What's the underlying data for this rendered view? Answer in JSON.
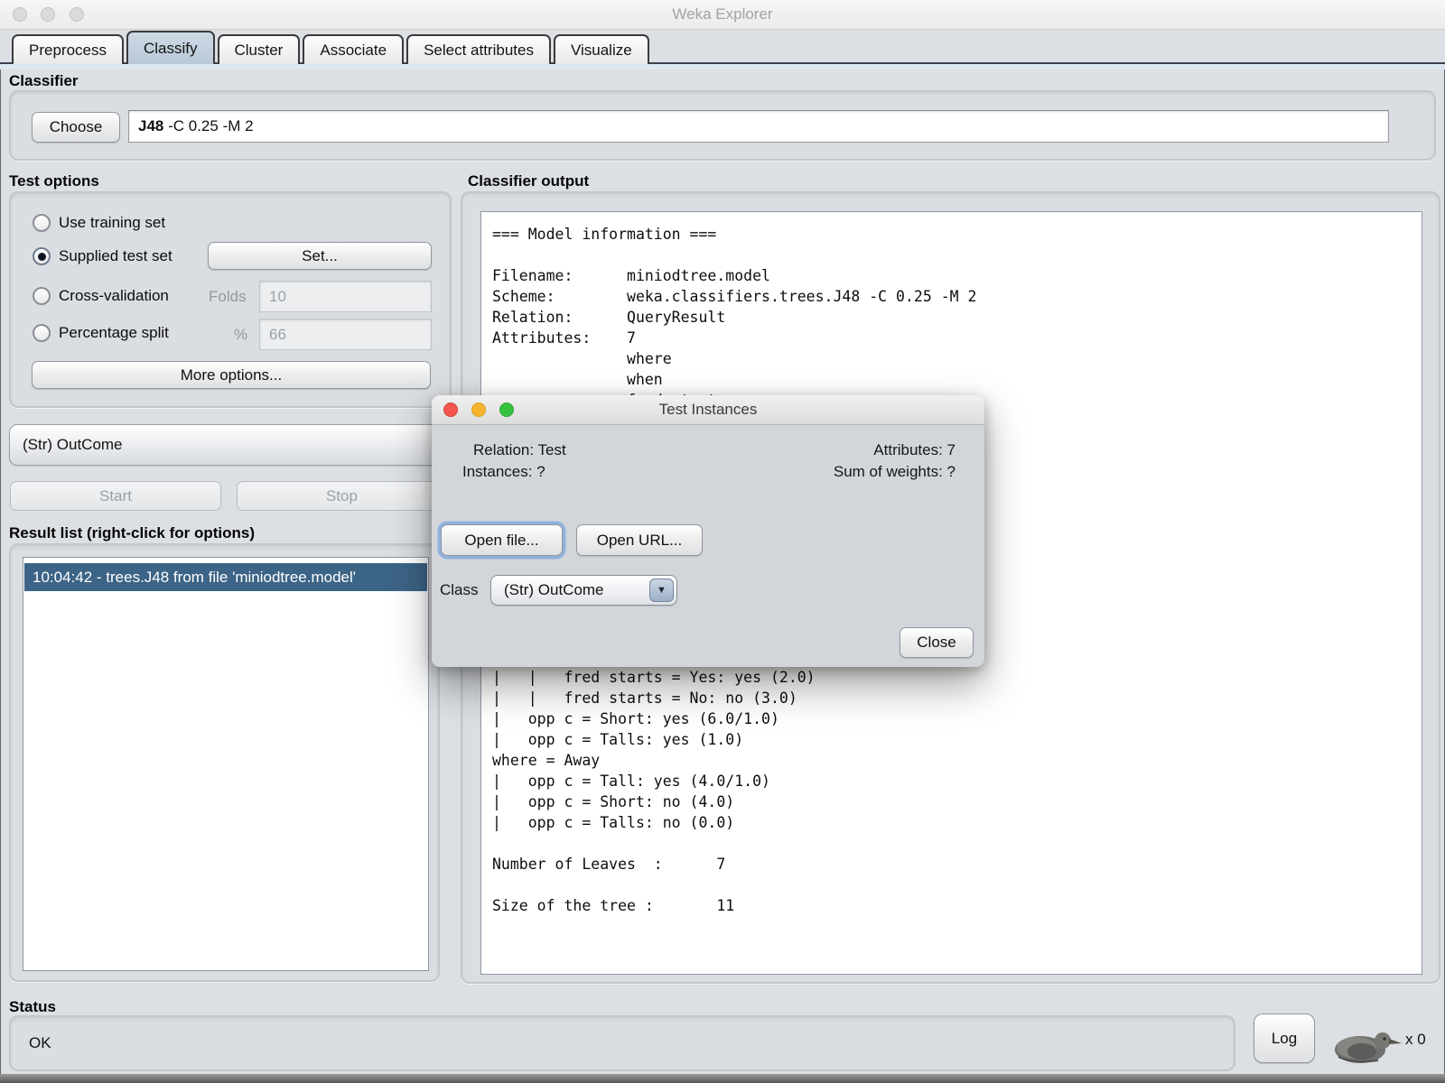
{
  "window": {
    "title": "Weka Explorer"
  },
  "tabs": {
    "items": [
      "Preprocess",
      "Classify",
      "Cluster",
      "Associate",
      "Select attributes",
      "Visualize"
    ],
    "selected": "Classify"
  },
  "classifier": {
    "section_label": "Classifier",
    "choose_button": "Choose",
    "name_bold": "J48",
    "name_rest": " -C 0.25 -M 2"
  },
  "test_options": {
    "section_label": "Test options",
    "use_training_set": "Use training set",
    "supplied_test_set": "Supplied test set",
    "set_button": "Set...",
    "cross_validation": "Cross-validation",
    "folds_label": "Folds",
    "folds_value": "10",
    "percentage_split": "Percentage split",
    "percent_label": "%",
    "percent_value": "66",
    "more_options_button": "More options..."
  },
  "class_combo": {
    "value": "(Str) OutCome"
  },
  "controls": {
    "start_button": "Start",
    "stop_button": "Stop"
  },
  "result_list": {
    "section_label": "Result list (right-click for options)",
    "items": [
      "10:04:42 - trees.J48 from file 'miniodtree.model'"
    ]
  },
  "classifier_output": {
    "section_label": "Classifier output",
    "model_info": "=== Model information ===\n\nFilename:      miniodtree.model\nScheme:        weka.classifiers.trees.J48 -C 0.25 -M 2\nRelation:      QueryResult\nAttributes:    7\n               where\n               when\n               fred starts",
    "tree_output": "|   |   fred starts = Yes: yes (2.0)\n|   |   fred starts = No: no (3.0)\n|   opp c = Short: yes (6.0/1.0)\n|   opp c = Talls: yes (1.0)\nwhere = Away\n|   opp c = Tall: yes (4.0/1.0)\n|   opp c = Short: no (4.0)\n|   opp c = Talls: no (0.0)\n\nNumber of Leaves  :      7\n\nSize of the tree :       11"
  },
  "dialog": {
    "title": "Test Instances",
    "relation": "Relation: Test",
    "instances": "Instances: ?",
    "attributes": "Attributes: 7",
    "sum_of_weights": "Sum of weights: ?",
    "open_file_button": "Open file...",
    "open_url_button": "Open URL...",
    "class_label": "Class",
    "class_value": "(Str) OutCome",
    "close_button": "Close"
  },
  "status": {
    "section_label": "Status",
    "message": "OK",
    "log_button": "Log",
    "bird_count": "x 0"
  },
  "icons": {
    "combo_arrow": "▼"
  },
  "colors": {
    "selection_blue": "#3c6486",
    "selected_tab": "#c3d1df",
    "traffic_red": "#f2564d",
    "traffic_yellow": "#f6b42e",
    "traffic_green": "#35c13e",
    "focus_ring": "#8fb2dd"
  }
}
